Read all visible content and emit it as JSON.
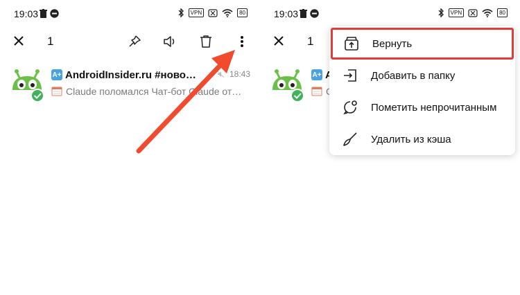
{
  "colors": {
    "accent_red": "#e33a3a",
    "arrow": "#f04a2f",
    "avatar_green": "#6cc04a",
    "check_green": "#3fb35a",
    "badge_blue": "#4aa3e0"
  },
  "left": {
    "status": {
      "time": "19:03",
      "tags": [
        "VPN",
        "80"
      ]
    },
    "actionbar": {
      "count": "1"
    },
    "chat": {
      "badge": "A+",
      "title": "AndroidInsider.ru #ново…",
      "time": "18:43",
      "preview": "Claude поломался  Чат-бот Claude от…"
    }
  },
  "right": {
    "status": {
      "time": "19:03",
      "tags": [
        "VPN",
        "80"
      ]
    },
    "actionbar": {
      "count": "1"
    },
    "chat": {
      "badge": "A+",
      "title": "A",
      "preview": "C"
    },
    "menu": {
      "items": [
        {
          "label": "Вернуть",
          "icon": "archive-icon"
        },
        {
          "label": "Добавить в папку",
          "icon": "folder-add-icon"
        },
        {
          "label": "Пометить непрочитанным",
          "icon": "mark-unread-icon"
        },
        {
          "label": "Удалить из кэша",
          "icon": "broom-icon"
        }
      ]
    }
  }
}
